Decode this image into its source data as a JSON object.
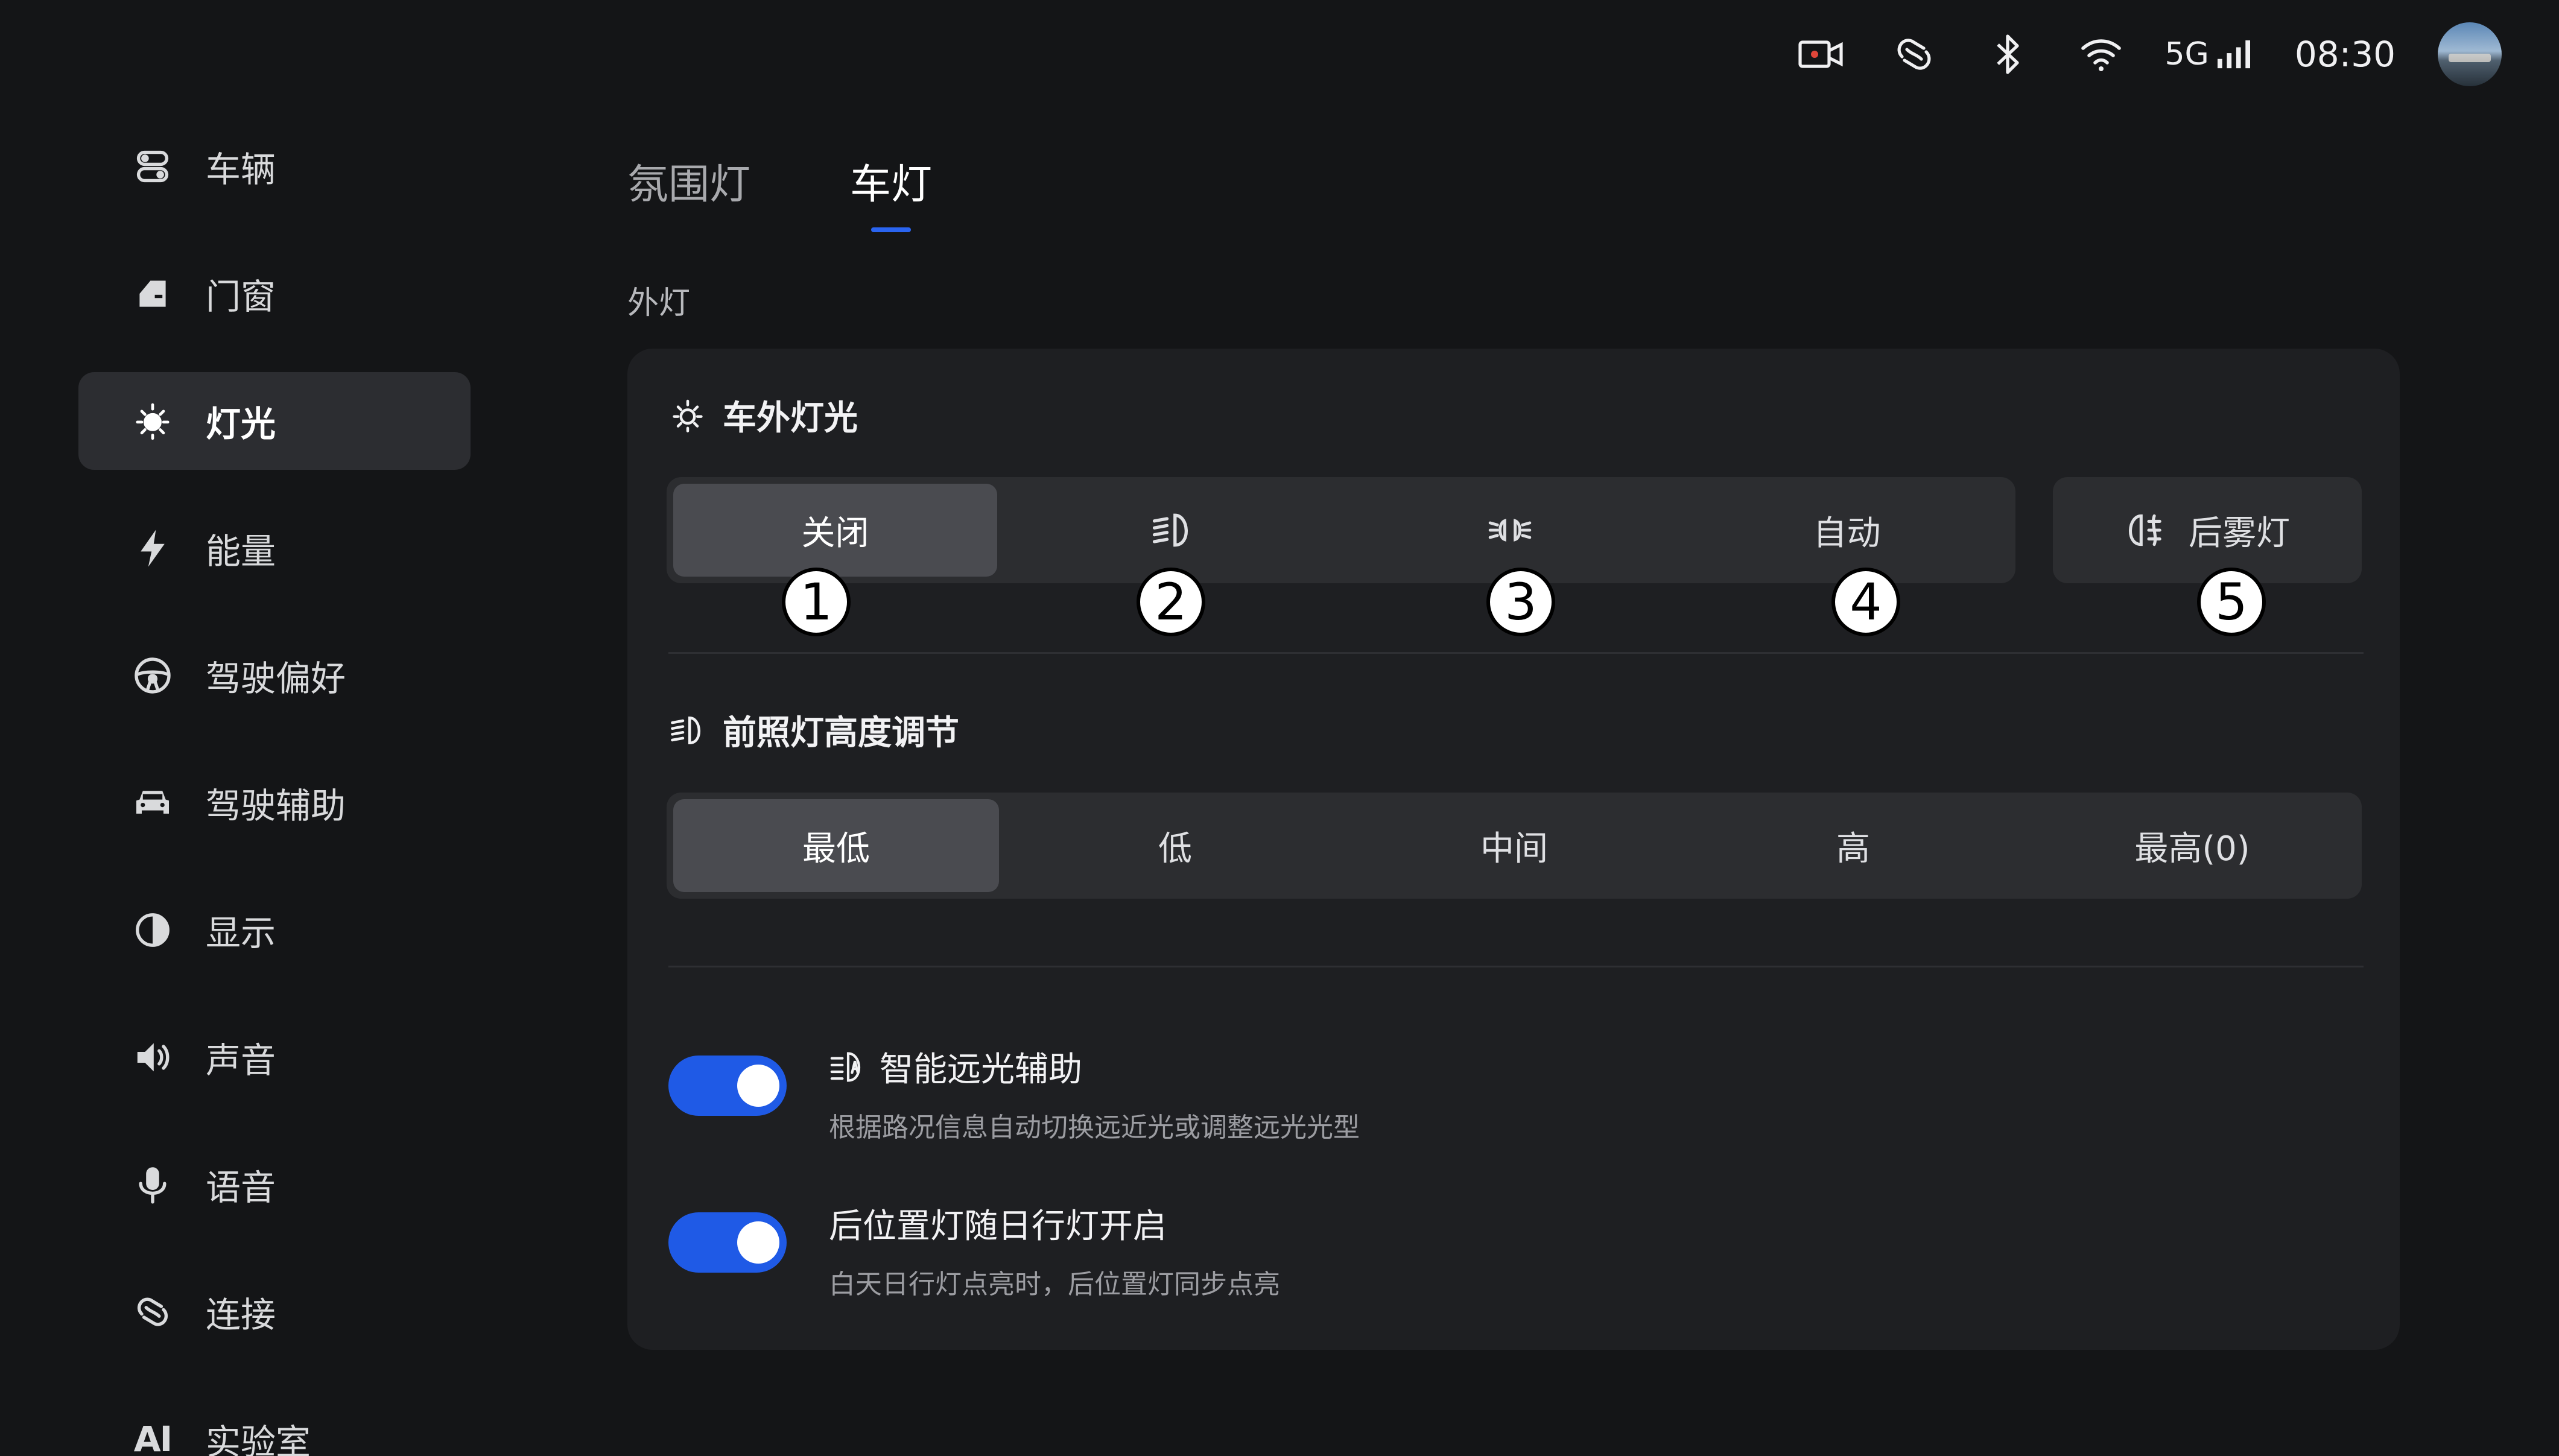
{
  "status_bar": {
    "network": "5G",
    "time": "08:30",
    "icons": [
      "dashcam-icon",
      "connect-icon",
      "bluetooth-icon",
      "wifi-icon",
      "signal-icon"
    ]
  },
  "sidebar": {
    "items": [
      {
        "label": "车辆",
        "icon": "vehicle-icon"
      },
      {
        "label": "门窗",
        "icon": "door-icon"
      },
      {
        "label": "灯光",
        "icon": "light-icon",
        "active": true
      },
      {
        "label": "能量",
        "icon": "bolt-icon"
      },
      {
        "label": "驾驶偏好",
        "icon": "steering-wheel-icon"
      },
      {
        "label": "驾驶辅助",
        "icon": "car-icon"
      },
      {
        "label": "显示",
        "icon": "contrast-icon"
      },
      {
        "label": "声音",
        "icon": "speaker-icon"
      },
      {
        "label": "语音",
        "icon": "microphone-icon"
      },
      {
        "label": "连接",
        "icon": "connect-icon"
      },
      {
        "label": "实验室",
        "icon_text": "AI"
      }
    ]
  },
  "tabs": [
    {
      "label": "氛围灯",
      "active": false
    },
    {
      "label": "车灯",
      "active": true
    }
  ],
  "section_label": "外灯",
  "exterior_lights": {
    "title": "车外灯光",
    "options": [
      {
        "label": "关闭",
        "selected": true
      },
      {
        "icon": "low-beam-icon"
      },
      {
        "icon": "position-light-icon"
      },
      {
        "label": "自动"
      }
    ],
    "fog_light_label": "后雾灯",
    "badges": [
      "1",
      "2",
      "3",
      "4",
      "5"
    ]
  },
  "headlight_height": {
    "title": "前照灯高度调节",
    "options": [
      {
        "label": "最低",
        "selected": true
      },
      {
        "label": "低"
      },
      {
        "label": "中间"
      },
      {
        "label": "高"
      },
      {
        "label": "最高(0)"
      }
    ]
  },
  "toggles": [
    {
      "title": "智能远光辅助",
      "subtitle": "根据路况信息自动切换远近光或调整远光光型",
      "on": true
    },
    {
      "title": "后位置灯随日行灯开启",
      "subtitle": "白天日行灯点亮时，后位置灯同步点亮",
      "on": true
    }
  ],
  "colors": {
    "accent": "#1f5ae6",
    "background": "#141517",
    "card": "#1e1f22"
  }
}
